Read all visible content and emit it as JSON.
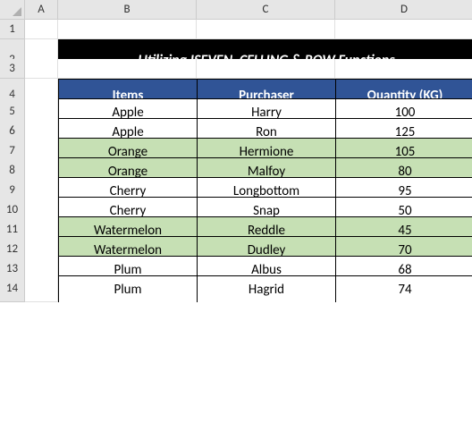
{
  "columns": [
    "A",
    "B",
    "C",
    "D"
  ],
  "rows": [
    "1",
    "2",
    "3",
    "4",
    "5",
    "6",
    "7",
    "8",
    "9",
    "10",
    "11",
    "12",
    "13",
    "14"
  ],
  "title": "Utilizing ISEVEN, CELLING & ROW Functions",
  "headers": {
    "items": "Items",
    "purchaser": "Purchaser",
    "quantity": "Quantity (KG)"
  },
  "chart_data": {
    "type": "table",
    "title": "Utilizing ISEVEN, CELLING & ROW Functions",
    "columns": [
      "Items",
      "Purchaser",
      "Quantity (KG)"
    ],
    "rows": [
      {
        "items": "Apple",
        "purchaser": "Harry",
        "quantity": 100,
        "shaded": false
      },
      {
        "items": "Apple",
        "purchaser": "Ron",
        "quantity": 125,
        "shaded": false
      },
      {
        "items": "Orange",
        "purchaser": "Hermione",
        "quantity": 105,
        "shaded": true
      },
      {
        "items": "Orange",
        "purchaser": "Malfoy",
        "quantity": 80,
        "shaded": true
      },
      {
        "items": "Cherry",
        "purchaser": "Longbottom",
        "quantity": 95,
        "shaded": false
      },
      {
        "items": "Cherry",
        "purchaser": "Snap",
        "quantity": 50,
        "shaded": false
      },
      {
        "items": "Watermelon",
        "purchaser": "Reddle",
        "quantity": 45,
        "shaded": true
      },
      {
        "items": "Watermelon",
        "purchaser": "Dudley",
        "quantity": 70,
        "shaded": true
      },
      {
        "items": "Plum",
        "purchaser": "Albus",
        "quantity": 68,
        "shaded": false
      },
      {
        "items": "Plum",
        "purchaser": "Hagrid",
        "quantity": 74,
        "shaded": false
      }
    ]
  }
}
